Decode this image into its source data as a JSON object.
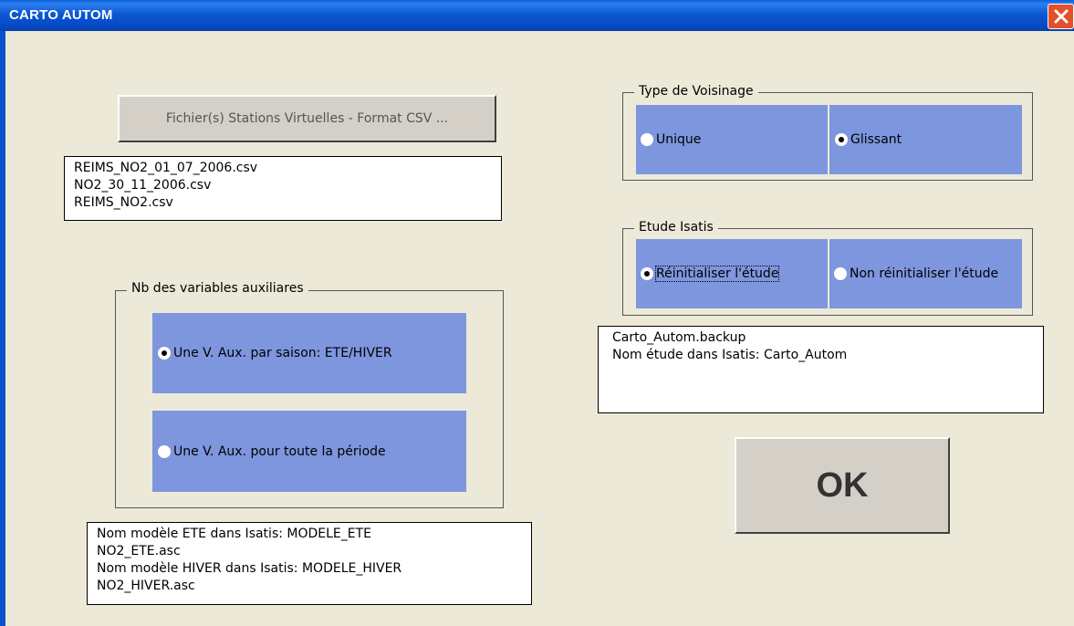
{
  "window": {
    "title": "CARTO AUTOM",
    "close_icon": "close-icon"
  },
  "csv_button": {
    "label": "Fichier(s) Stations Virtuelles - Format CSV ..."
  },
  "csv_files": [
    "REIMS_NO2_01_07_2006.csv",
    "NO2_30_11_2006.csv",
    "REIMS_NO2.csv"
  ],
  "aux_group": {
    "legend": "Nb des variables auxiliares",
    "options": [
      {
        "label": "Une V. Aux. par saison: ETE/HIVER",
        "selected": true
      },
      {
        "label": "Une V. Aux. pour toute la période",
        "selected": false
      }
    ]
  },
  "model_info": [
    "Nom modèle ETE dans Isatis: MODELE_ETE",
    "NO2_ETE.asc",
    "Nom modèle HIVER dans Isatis: MODELE_HIVER",
    "NO2_HIVER.asc"
  ],
  "voisinage_group": {
    "legend": "Type de Voisinage",
    "options": [
      {
        "label": "Unique",
        "selected": false
      },
      {
        "label": "Glissant",
        "selected": true
      }
    ]
  },
  "etude_group": {
    "legend": "Etude Isatis",
    "options": [
      {
        "label": "Réinitialiser l'étude",
        "selected": true
      },
      {
        "label": "Non réinitialiser l'étude",
        "selected": false
      }
    ]
  },
  "study_info": [
    "Carto_Autom.backup",
    "Nom étude dans Isatis: Carto_Autom"
  ],
  "ok_button": {
    "label": "OK"
  },
  "colors": {
    "option_bg": "#7d96de",
    "titlebar": "#0b58d3",
    "window_bg": "#ece9d8"
  }
}
